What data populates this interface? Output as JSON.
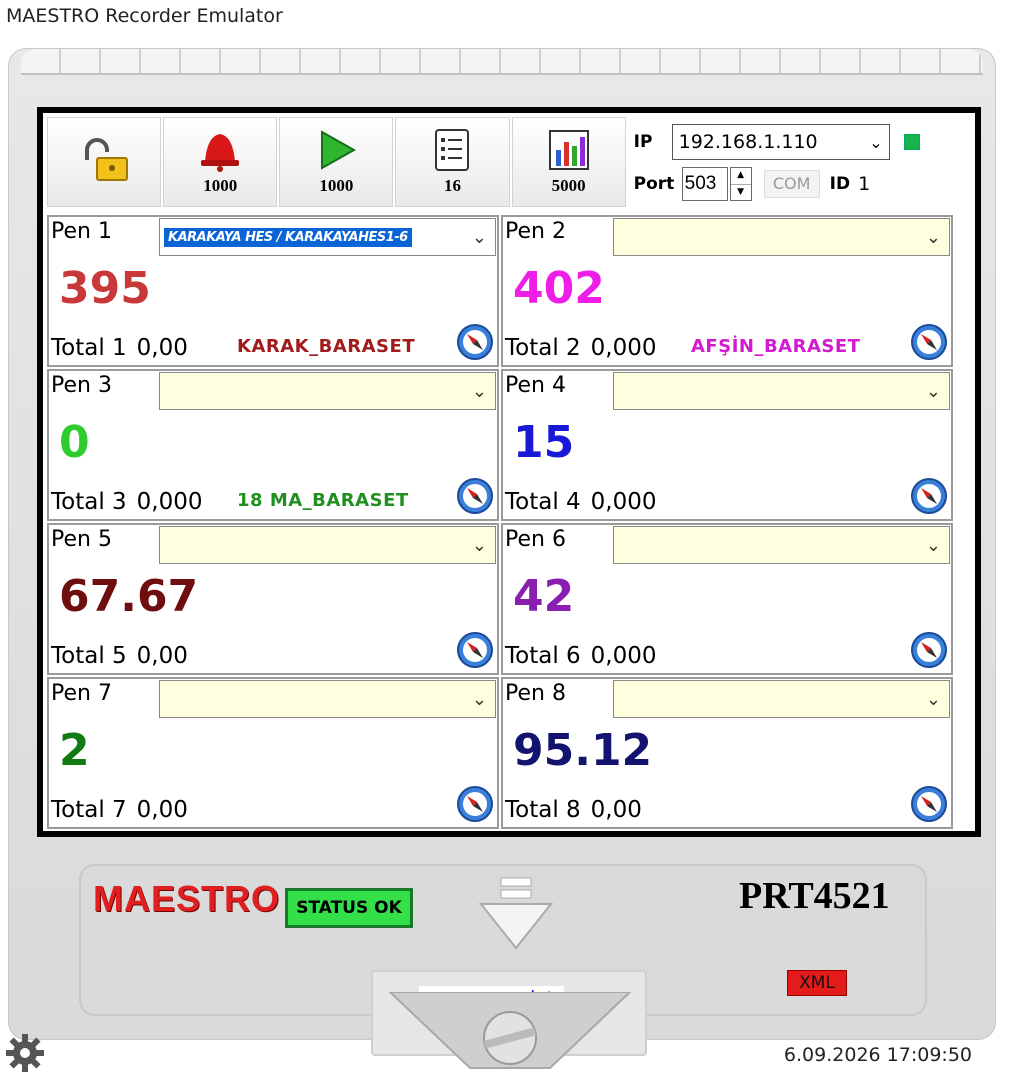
{
  "window": {
    "title": "MAESTRO Recorder Emulator"
  },
  "toolbar": {
    "lock_value": "",
    "alarm_value": "1000",
    "play_value": "1000",
    "list_value": "16",
    "chart_value": "5000"
  },
  "connection": {
    "ip_label": "IP",
    "ip_value": "192.168.1.110",
    "port_label": "Port",
    "port_value": "503",
    "com_label": "COM",
    "id_label": "ID",
    "id_value": "1",
    "status_color": "#19b34b"
  },
  "pens": [
    {
      "name": "Pen 1",
      "selected": "KARAKAYA HES / KARAKAYAHES1-6",
      "value": "395",
      "total_label": "Total 1",
      "total_value": "0,00",
      "tag": "KARAK_BARASET",
      "value_color": "#c83838",
      "tag_color": "#a01c1c"
    },
    {
      "name": "Pen 2",
      "selected": "",
      "value": "402",
      "total_label": "Total 2",
      "total_value": "0,000",
      "tag": "AFŞİN_BARASET",
      "value_color": "#ee1ee8",
      "tag_color": "#d21ad0"
    },
    {
      "name": "Pen 3",
      "selected": "",
      "value": "0",
      "total_label": "Total 3",
      "total_value": "0,000",
      "tag": "18 MA_BARASET",
      "value_color": "#2ecc2e",
      "tag_color": "#1f8f1f"
    },
    {
      "name": "Pen 4",
      "selected": "",
      "value": "15",
      "total_label": "Total 4",
      "total_value": "0,000",
      "tag": "",
      "value_color": "#1818d6",
      "tag_color": "#1818d6"
    },
    {
      "name": "Pen 5",
      "selected": "",
      "value": "67.67",
      "total_label": "Total 5",
      "total_value": "0,00",
      "tag": "",
      "value_color": "#6e0e0e",
      "tag_color": "#6e0e0e"
    },
    {
      "name": "Pen 6",
      "selected": "",
      "value": "42",
      "total_label": "Total 6",
      "total_value": "0,000",
      "tag": "",
      "value_color": "#8a1eb0",
      "tag_color": "#8a1eb0"
    },
    {
      "name": "Pen 7",
      "selected": "",
      "value": "2",
      "total_label": "Total 7",
      "total_value": "0,00",
      "tag": "",
      "value_color": "#127a12",
      "tag_color": "#127a12"
    },
    {
      "name": "Pen 8",
      "selected": "",
      "value": "95.12",
      "total_label": "Total 8",
      "total_value": "0,00",
      "tag": "",
      "value_color": "#141470",
      "tag_color": "#141470"
    }
  ],
  "device": {
    "brand": "MAESTRO",
    "status": "STATUS OK",
    "model": "PRT4521",
    "xml_badge": "XML",
    "website": "www.eos.web.tr"
  },
  "footer": {
    "datetime": "6.09.2026 17:09:50",
    "settings_icon": "gear-icon"
  }
}
